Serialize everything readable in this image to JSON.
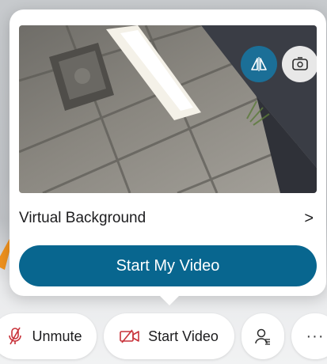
{
  "camera_preview": {
    "mirror_icon": "mirror-flip-icon",
    "switch_icon": "camera-switch-icon"
  },
  "virtual_background": {
    "label": "Virtual Background",
    "chevron": ">"
  },
  "start_my_video": {
    "label": "Start My Video"
  },
  "toolbar": {
    "unmute_label": "Unmute",
    "start_video_label": "Start Video",
    "more_label": "···"
  },
  "colors": {
    "accent": "#08668f",
    "mirror_button": "#1b6f97",
    "alert_red": "#c8323a",
    "pointer_orange": "#f0921e"
  }
}
